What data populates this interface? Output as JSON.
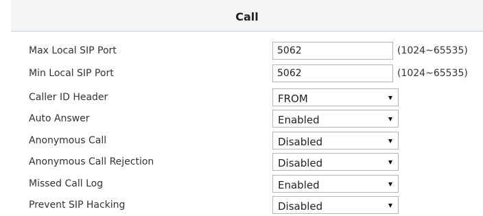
{
  "section": {
    "title": "Call"
  },
  "fields": {
    "max_local_sip_port": {
      "label": "Max Local SIP Port",
      "value": "5062",
      "hint": "(1024~65535)"
    },
    "min_local_sip_port": {
      "label": "Min Local SIP Port",
      "value": "5062",
      "hint": "(1024~65535)"
    },
    "caller_id_header": {
      "label": "Caller ID Header",
      "value": "FROM"
    },
    "auto_answer": {
      "label": "Auto Answer",
      "value": "Enabled"
    },
    "anonymous_call": {
      "label": "Anonymous Call",
      "value": "Disabled"
    },
    "anonymous_call_rejection": {
      "label": "Anonymous Call Rejection",
      "value": "Disabled"
    },
    "missed_call_log": {
      "label": "Missed Call Log",
      "value": "Enabled"
    },
    "prevent_sip_hacking": {
      "label": "Prevent SIP Hacking",
      "value": "Disabled"
    }
  },
  "icons": {
    "dropdown_arrow": "chevron-down-icon"
  }
}
